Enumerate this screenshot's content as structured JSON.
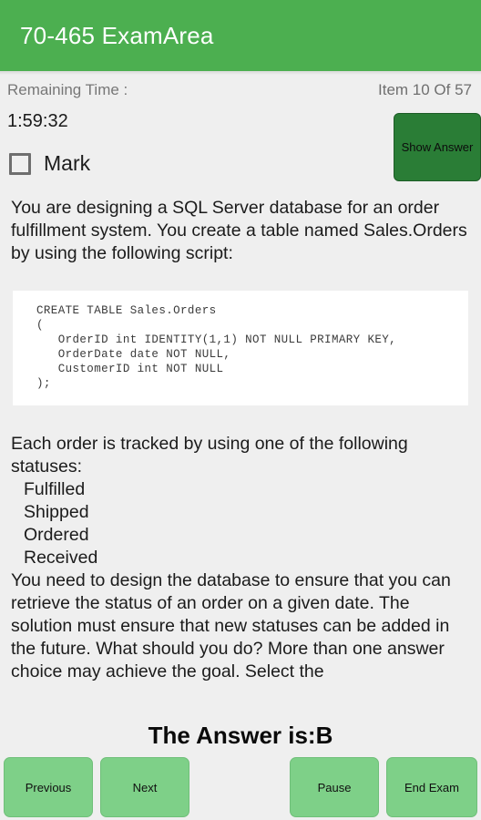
{
  "titlebar": {
    "title": "70-465 ExamArea"
  },
  "status": {
    "remaining_label": "Remaining Time :",
    "item_counter": "Item 10 Of 57"
  },
  "timer": {
    "value": "1:59:32"
  },
  "mark": {
    "label": "Mark",
    "checked": false,
    "checkbox_icon": "empty-checkbox-icon"
  },
  "show_answer_button": {
    "label": "Show Answer",
    "color": "#2a7d36"
  },
  "question": {
    "intro": "You are designing a SQL Server database for an order fulfillment system. You create a table named Sales.Orders by using the following script:",
    "code": "CREATE TABLE Sales.Orders\n(\n   OrderID int IDENTITY(1,1) NOT NULL PRIMARY KEY,\n   OrderDate date NOT NULL,\n   CustomerID int NOT NULL\n);",
    "statuses_intro": "Each order is tracked by using one of the following statuses:",
    "statuses": "  Fulfilled\n  Shipped\n  Ordered\n  Received",
    "body": "You need to design the database to ensure that you can retrieve the status of an order on a given date. The solution must ensure that new statuses can be added in the future. What should you do? More than one answer choice may achieve the goal. Select the"
  },
  "answer": {
    "text": "The Answer is:B"
  },
  "buttons": {
    "previous": "Previous",
    "next": "Next",
    "pause": "Pause",
    "end_exam": "End Exam",
    "color": "#7ed088"
  },
  "theme": {
    "header_green": "#4caf50",
    "page_background": "#efefef"
  }
}
